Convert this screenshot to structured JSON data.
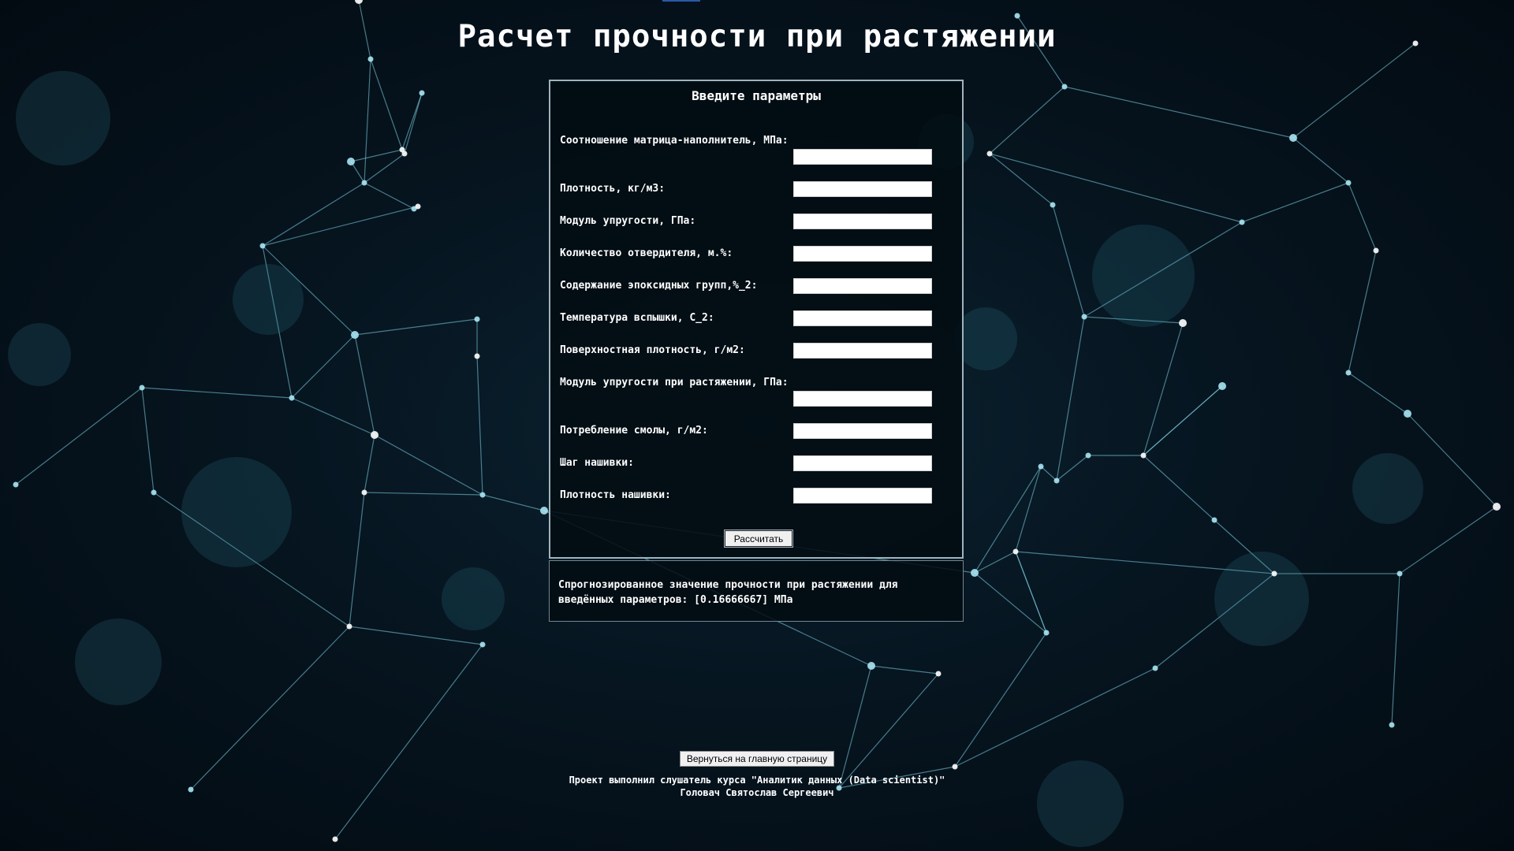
{
  "page": {
    "title": "Расчет прочности при растяжении",
    "background_icon": "neural-network-background",
    "accent_color": "#4fb3c9"
  },
  "form": {
    "title": "Введите параметры",
    "fields": [
      {
        "label": "Соотношение матрица-наполнитель, МПа:",
        "value": ""
      },
      {
        "label": "Плотность, кг/м3:",
        "value": ""
      },
      {
        "label": "Модуль упругости, ГПа:",
        "value": ""
      },
      {
        "label": "Количество отвердителя, м.%:",
        "value": ""
      },
      {
        "label": "Содержание эпоксидных групп,%_2:",
        "value": ""
      },
      {
        "label": "Температура вспышки, С_2:",
        "value": ""
      },
      {
        "label": "Поверхностная плотность, г/м2:",
        "value": ""
      },
      {
        "label": "Модуль упругости при растяжении, ГПа:",
        "value": ""
      },
      {
        "label": "Потребление смолы, г/м2:",
        "value": ""
      },
      {
        "label": "Шаг нашивки:",
        "value": ""
      },
      {
        "label": "Плотность нашивки:",
        "value": ""
      }
    ],
    "submit_label": "Рассчитать"
  },
  "result": {
    "text": "Спрогнозированное значение прочности при растяжении для введённых параметров: [0.16666667] МПа"
  },
  "nav": {
    "back_label": "Вернуться на главную страницу"
  },
  "footer": {
    "line1": "Проект выполнил слушатель курса \"Аналитик данных (Data scientist)\"",
    "line2": "Головач Святослав Сергеевич"
  }
}
